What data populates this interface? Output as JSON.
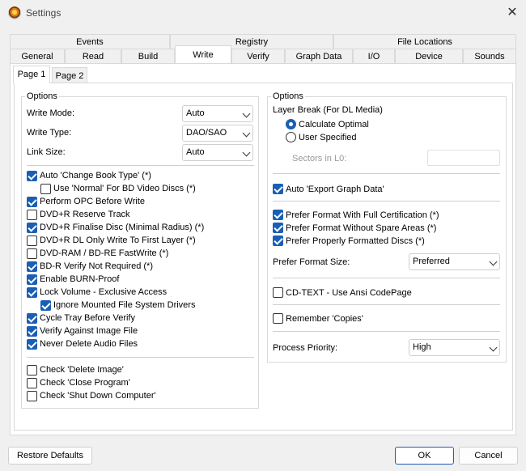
{
  "window": {
    "title": "Settings"
  },
  "tabs_row1": [
    {
      "label": "Events"
    },
    {
      "label": "Registry"
    },
    {
      "label": "File Locations"
    }
  ],
  "tabs_row2": [
    {
      "label": "General"
    },
    {
      "label": "Read"
    },
    {
      "label": "Build"
    },
    {
      "label": "Write",
      "active": true
    },
    {
      "label": "Verify"
    },
    {
      "label": "Graph Data"
    },
    {
      "label": "I/O"
    },
    {
      "label": "Device"
    },
    {
      "label": "Sounds"
    }
  ],
  "subtabs": [
    {
      "label": "Page 1",
      "active": true
    },
    {
      "label": "Page 2"
    }
  ],
  "left": {
    "group_title": "Options",
    "write_mode": {
      "label": "Write Mode:",
      "value": "Auto"
    },
    "write_type": {
      "label": "Write Type:",
      "value": "DAO/SAO"
    },
    "link_size": {
      "label": "Link Size:",
      "value": "Auto"
    },
    "checks": [
      {
        "label": "Auto 'Change Book Type' (*)",
        "checked": true
      },
      {
        "label": "Use 'Normal' For BD Video Discs (*)",
        "checked": false
      },
      {
        "label": "Perform OPC Before Write",
        "checked": true
      },
      {
        "label": "DVD+R Reserve Track",
        "checked": false
      },
      {
        "label": "DVD+R Finalise Disc (Minimal Radius) (*)",
        "checked": true
      },
      {
        "label": "DVD+R DL Only Write To First Layer (*)",
        "checked": false
      },
      {
        "label": "DVD-RAM / BD-RE FastWrite (*)",
        "checked": false
      },
      {
        "label": "BD-R Verify Not Required (*)",
        "checked": true
      },
      {
        "label": "Enable BURN-Proof",
        "checked": true
      },
      {
        "label": "Lock Volume - Exclusive Access",
        "checked": true
      },
      {
        "label": "Ignore Mounted File System Drivers",
        "checked": true
      },
      {
        "label": "Cycle Tray Before Verify",
        "checked": true
      },
      {
        "label": "Verify Against Image File",
        "checked": true
      },
      {
        "label": "Never Delete Audio Files",
        "checked": true
      },
      {
        "label": "Check 'Delete Image'",
        "checked": false
      },
      {
        "label": "Check 'Close Program'",
        "checked": false
      },
      {
        "label": "Check 'Shut Down Computer'",
        "checked": false
      }
    ]
  },
  "right": {
    "group_title": "Options",
    "layer_break_label": "Layer Break (For DL Media)",
    "radio_calc": {
      "label": "Calculate Optimal",
      "checked": true
    },
    "radio_user": {
      "label": "User Specified",
      "checked": false
    },
    "sectors_label": "Sectors in L0:",
    "sectors_value": "",
    "auto_export": {
      "label": "Auto 'Export Graph Data'",
      "checked": true
    },
    "prefer_full_cert": {
      "label": "Prefer Format With Full Certification (*)",
      "checked": true
    },
    "prefer_no_spare": {
      "label": "Prefer Format Without Spare Areas (*)",
      "checked": true
    },
    "prefer_proper": {
      "label": "Prefer Properly Formatted Discs (*)",
      "checked": true
    },
    "prefer_format_size": {
      "label": "Prefer Format Size:",
      "value": "Preferred"
    },
    "cdtext": {
      "label": "CD-TEXT - Use Ansi CodePage",
      "checked": false
    },
    "remember_copies": {
      "label": "Remember 'Copies'",
      "checked": false
    },
    "process_priority": {
      "label": "Process Priority:",
      "value": "High"
    }
  },
  "buttons": {
    "restore": "Restore Defaults",
    "ok": "OK",
    "cancel": "Cancel"
  },
  "icons": {
    "close": "close-icon",
    "app": "app-icon"
  },
  "colors": {
    "accent": "#1a5fb4"
  }
}
